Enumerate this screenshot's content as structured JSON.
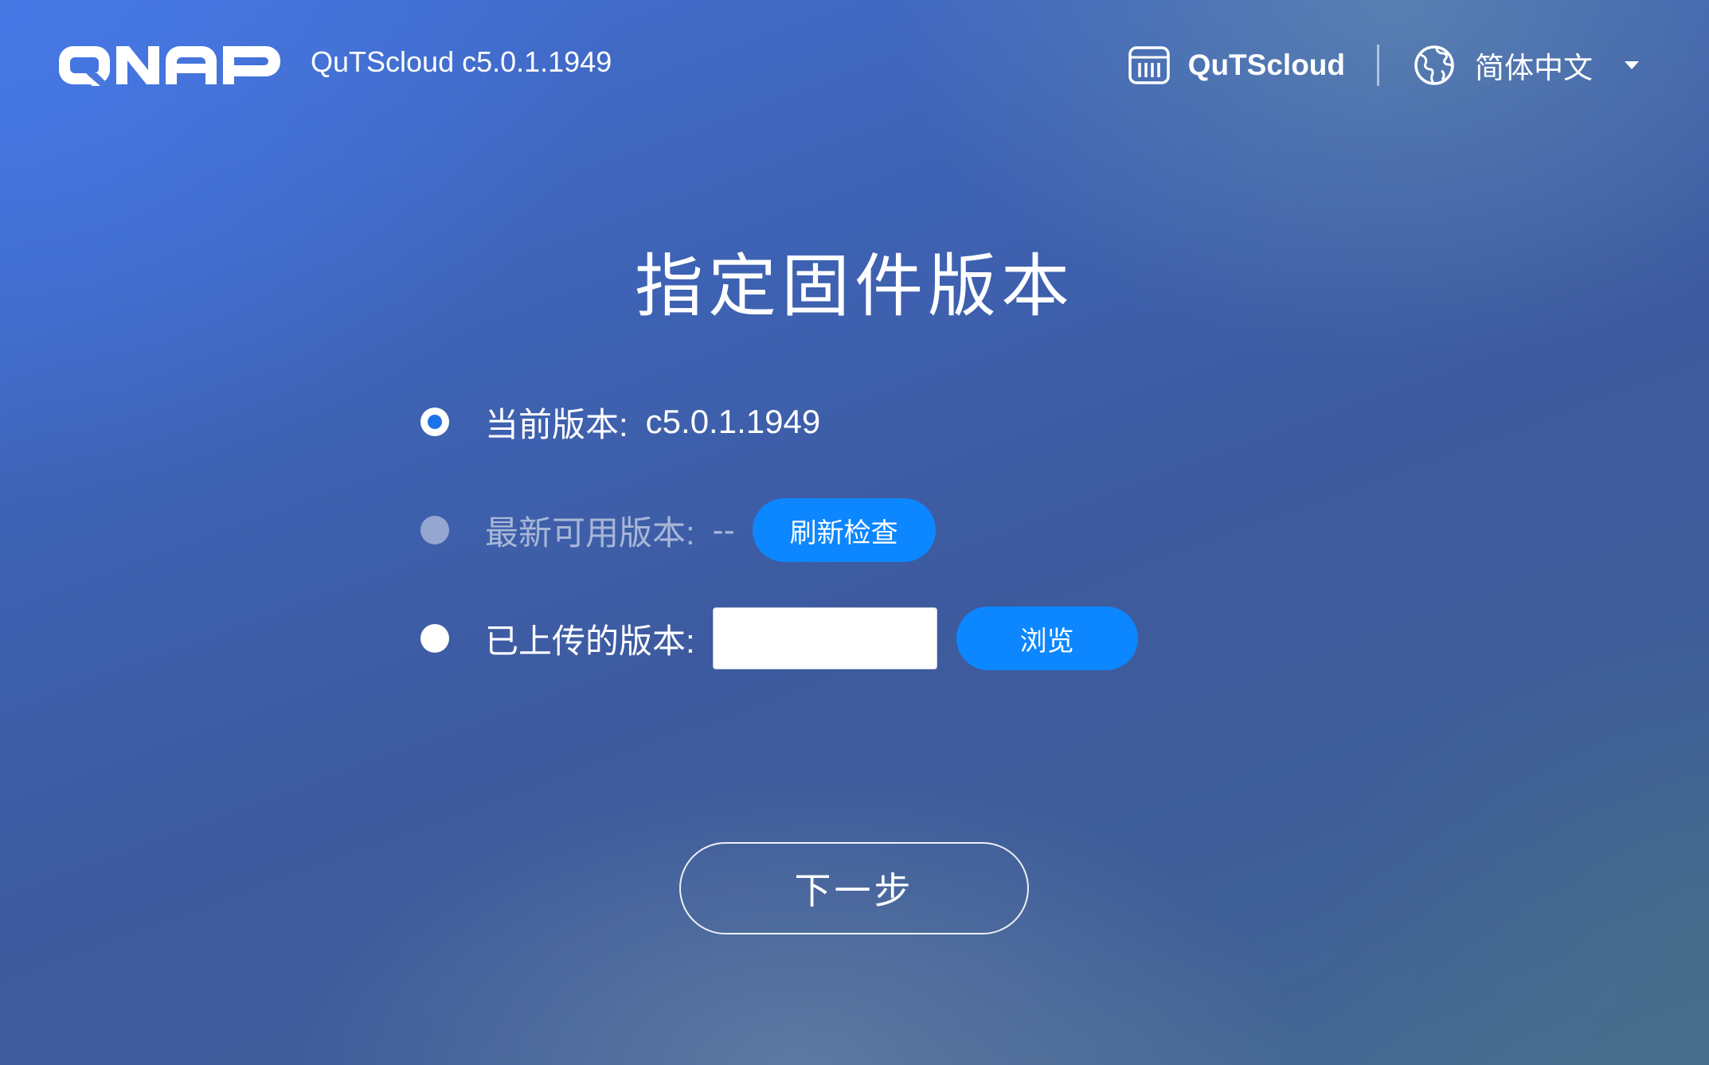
{
  "header": {
    "logo_text": "QNAP",
    "version_label": "QuTScloud c5.0.1.1949",
    "product_name": "QuTScloud",
    "product_icon": "nas-device-icon",
    "language_icon": "globe-icon",
    "language": "简体中文"
  },
  "main": {
    "title": "指定固件版本",
    "options": [
      {
        "label": "当前版本:",
        "value": "c5.0.1.1949",
        "selected": true,
        "enabled": true
      },
      {
        "label": "最新可用版本:",
        "value": "--",
        "selected": false,
        "enabled": false,
        "button_label": "刷新检查"
      },
      {
        "label": "已上传的版本:",
        "input_value": "",
        "selected": false,
        "enabled": true,
        "button_label": "浏览"
      }
    ],
    "next_label": "下一步"
  },
  "colors": {
    "accent": "#0d87ff",
    "radio_selected": "#1a73e8",
    "background_start": "#4472d8",
    "background_end": "#3d5a9e"
  }
}
